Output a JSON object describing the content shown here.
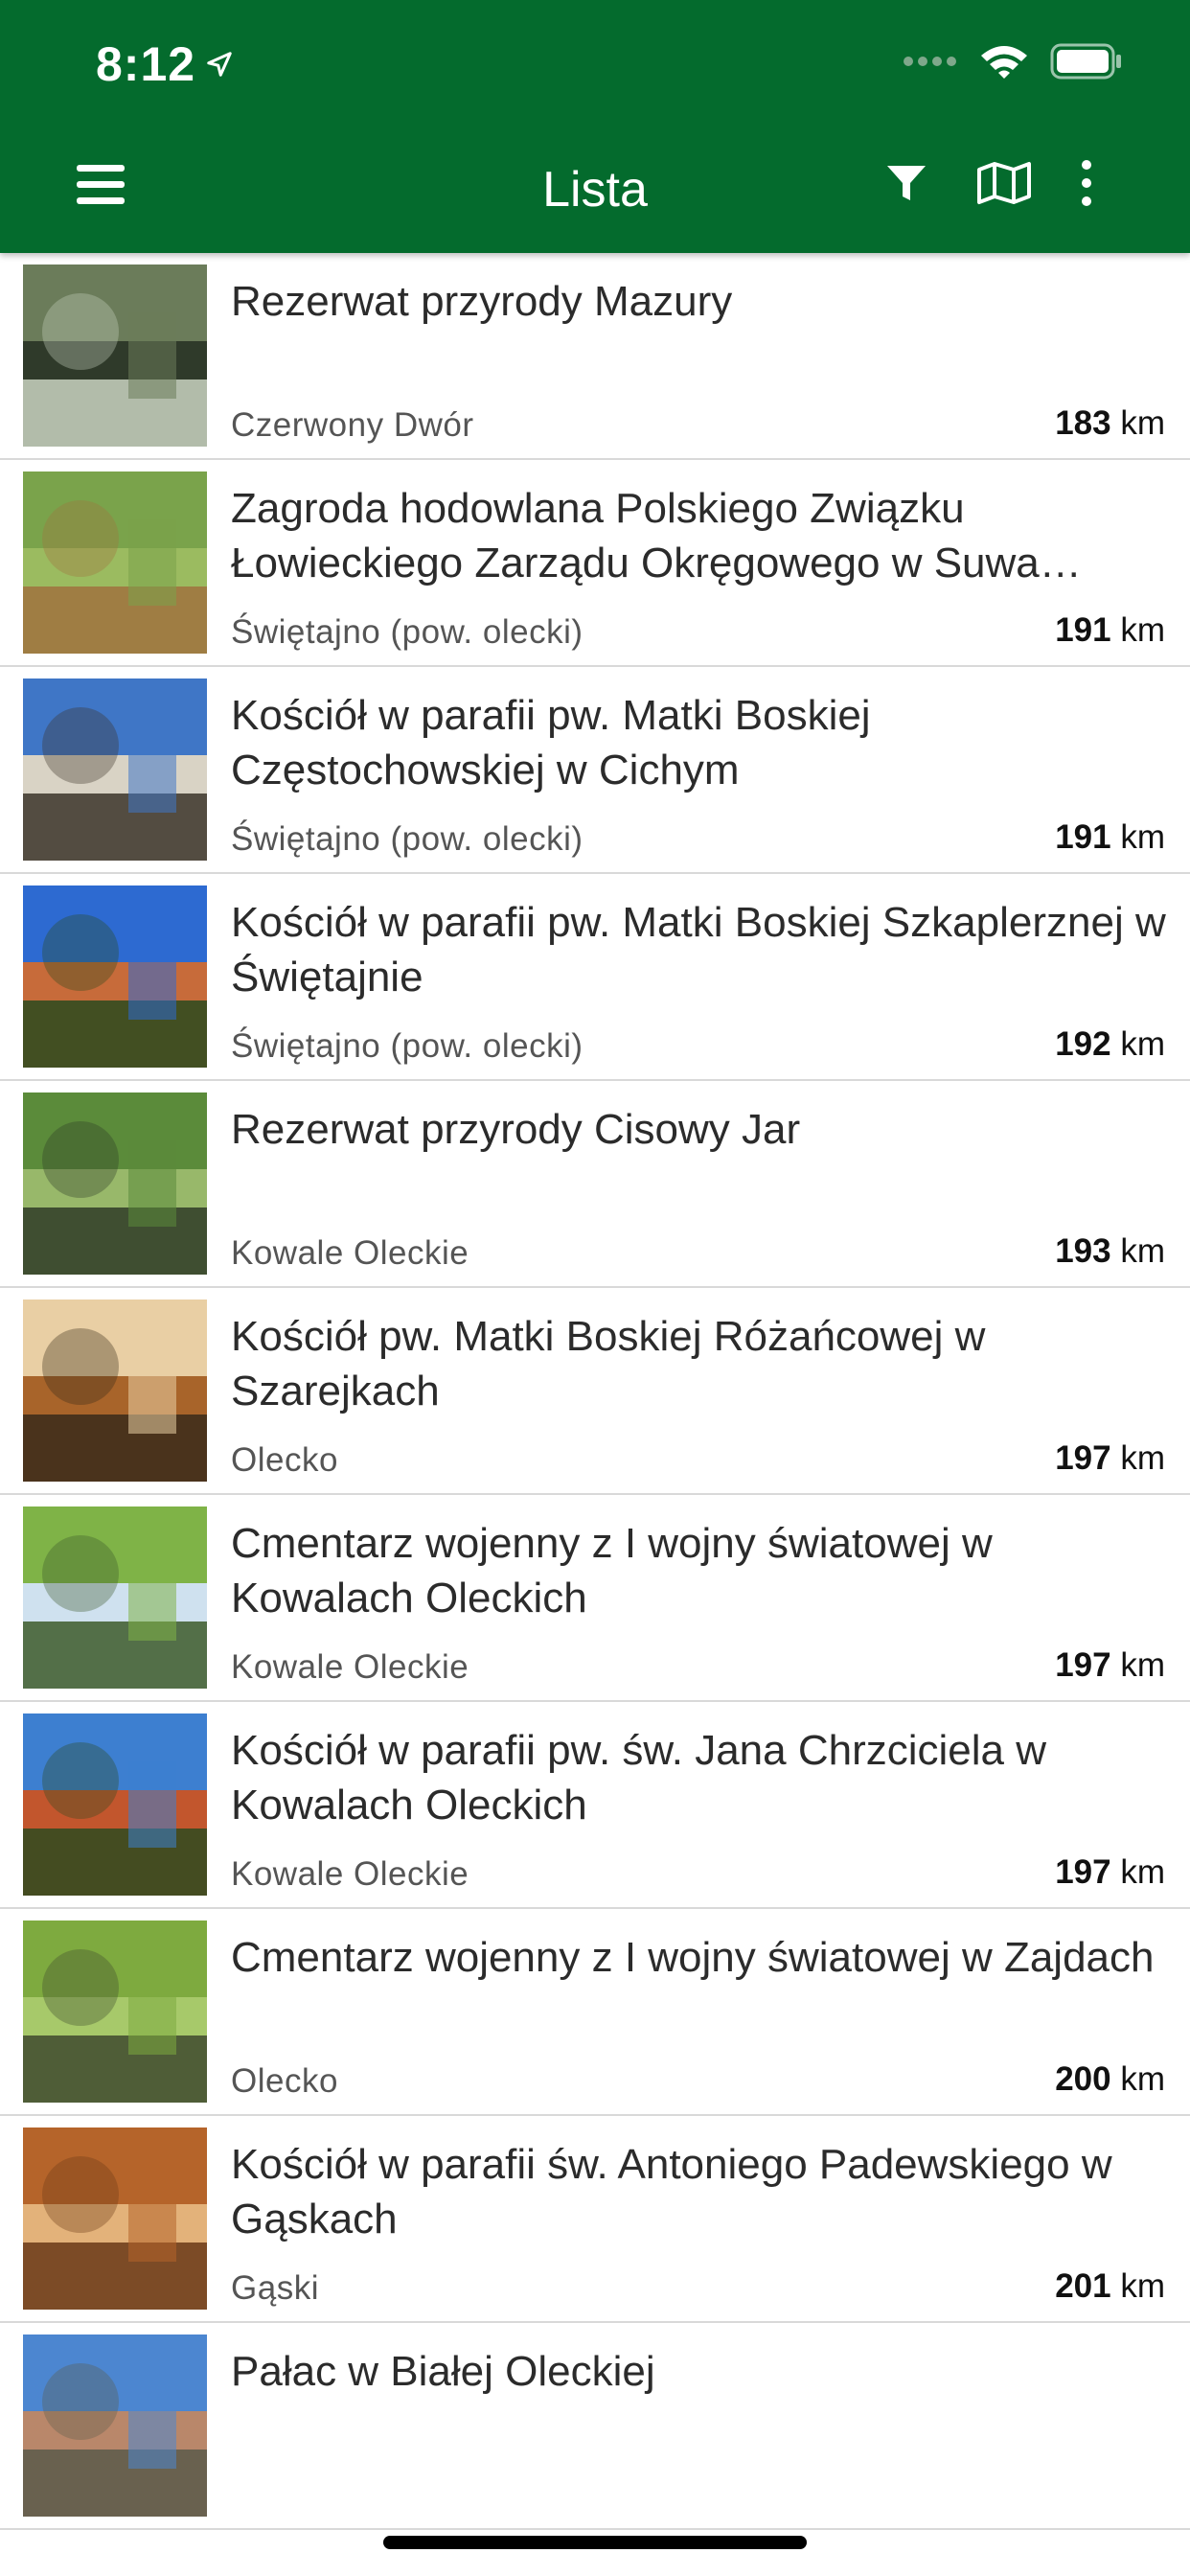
{
  "status_bar": {
    "time": "8:12"
  },
  "nav": {
    "title": "Lista",
    "left_icon": "hamburger-menu-icon",
    "right_icons": [
      "filter-icon",
      "map-icon",
      "more-vertical-icon"
    ]
  },
  "list_items": [
    {
      "title": "Rezerwat przyrody Mazury",
      "location": "Czerwony Dwór",
      "distance_value": "183",
      "distance_unit": "km",
      "thumb_colors": [
        "#6b7c5a",
        "#2f3a2a",
        "#c9d4c1"
      ]
    },
    {
      "title": "Zagroda hodowlana Polskiego Związku Łowieckiego Zarządu Okręgowego w Suwa…",
      "location": "Świętajno (pow. olecki)",
      "distance_value": "191",
      "distance_unit": "km",
      "thumb_colors": [
        "#7aa34b",
        "#9bbb60",
        "#a0723e"
      ]
    },
    {
      "title": "Kościół w parafii pw. Matki Boskiej Częstochowskiej w Cichym",
      "location": "Świętajno (pow. olecki)",
      "distance_value": "191",
      "distance_unit": "km",
      "thumb_colors": [
        "#3f76c6",
        "#d9d3c5",
        "#3b3429"
      ]
    },
    {
      "title": "Kościół w parafii pw. Matki Boskiej Szkaplerznej w Świętajnie",
      "location": "Świętajno (pow. olecki)",
      "distance_value": "192",
      "distance_unit": "km",
      "thumb_colors": [
        "#2d6ad1",
        "#c76b3a",
        "#2a4a1e"
      ]
    },
    {
      "title": "Rezerwat przyrody Cisowy Jar",
      "location": "Kowale Oleckie",
      "distance_value": "193",
      "distance_unit": "km",
      "thumb_colors": [
        "#5b8b3a",
        "#98b86a",
        "#2f3b27"
      ]
    },
    {
      "title": "Kościół pw. Matki Boskiej Różańcowej w Szarejkach",
      "location": "Olecko",
      "distance_value": "197",
      "distance_unit": "km",
      "thumb_colors": [
        "#e9cfa4",
        "#a8642a",
        "#3a2a1a"
      ]
    },
    {
      "title": "Cmentarz wojenny z I wojny światowej w Kowalach Oleckich",
      "location": "Kowale Oleckie",
      "distance_value": "197",
      "distance_unit": "km",
      "thumb_colors": [
        "#7fb347",
        "#cfe1ef",
        "#3d5a2a"
      ]
    },
    {
      "title": "Kościół w parafii pw. św. Jana Chrzciciela w Kowalach Oleckich",
      "location": "Kowale Oleckie",
      "distance_value": "197",
      "distance_unit": "km",
      "thumb_colors": [
        "#3d7fd0",
        "#c2562d",
        "#2e4a20"
      ]
    },
    {
      "title": "Cmentarz wojenny z I wojny światowej w Zajdach",
      "location": "Olecko",
      "distance_value": "200",
      "distance_unit": "km",
      "thumb_colors": [
        "#7eaa3f",
        "#a7c96a",
        "#3f4a2e"
      ]
    },
    {
      "title": "Kościół w parafii św. Antoniego Padewskiego w Gąskach",
      "location": "Gąski",
      "distance_value": "201",
      "distance_unit": "km",
      "thumb_colors": [
        "#b5642a",
        "#e3b27a",
        "#6a3817"
      ]
    },
    {
      "title": "Pałac w Białej Oleckiej",
      "location": "",
      "distance_value": "",
      "distance_unit": "",
      "thumb_colors": [
        "#4c86d0",
        "#b9876a",
        "#5b5b4a"
      ]
    }
  ]
}
